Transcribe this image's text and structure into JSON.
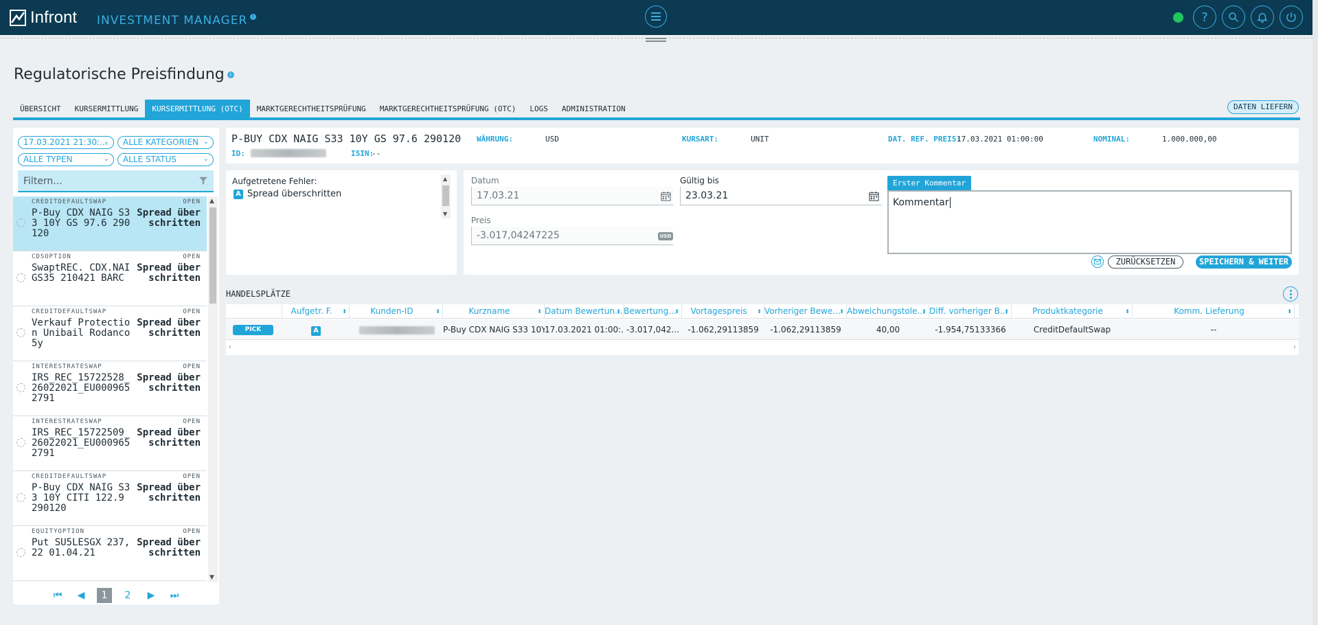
{
  "app": {
    "logo_text": "Infront",
    "title": "INVESTMENT MANAGER",
    "page_title": "Regulatorische Preisfindung"
  },
  "topbar_icons": [
    "menu-icon",
    "status-online",
    "help-icon",
    "search-icon",
    "bell-icon",
    "power-icon"
  ],
  "colors": {
    "primary": "#21a5d9",
    "topbar": "#0b3a52",
    "status_online": "#22c55e"
  },
  "tabs": [
    {
      "label": "ÜBERSICHT",
      "active": false
    },
    {
      "label": "KURSERMITTLUNG",
      "active": false
    },
    {
      "label": "KURSERMITTLUNG (OTC)",
      "active": true
    },
    {
      "label": "MARKTGERECHTHEITSPRÜFUNG",
      "active": false
    },
    {
      "label": "MARKTGERECHTHEITSPRÜFUNG (OTC)",
      "active": false
    },
    {
      "label": "LOGS",
      "active": false
    },
    {
      "label": "ADMINISTRATION",
      "active": false
    }
  ],
  "deliver_button": "DATEN LIEFERN",
  "filters": {
    "date": "17.03.2021 21:30:...",
    "categories": "ALLE KATEGORIEN",
    "types": "ALLE TYPEN",
    "status": "ALLE STATUS",
    "search_placeholder": "Filtern..."
  },
  "list_items": [
    {
      "type": "CREDITDEFAULTSWAP",
      "status": "OPEN",
      "name": "P-Buy CDX NAIG S33 10Y GS 97.6 290120",
      "msg": "Spread überschritten",
      "selected": true
    },
    {
      "type": "CDSOPTION",
      "status": "OPEN",
      "name": "SwaptREC. CDX.NAIGS35 210421 BARC",
      "msg": "Spread überschritten",
      "selected": false
    },
    {
      "type": "CREDITDEFAULTSWAP",
      "status": "OPEN",
      "name": "Verkauf Protection Unibail Rodanco 5y",
      "msg": "Spread überschritten",
      "selected": false
    },
    {
      "type": "INTERESTRATESWAP",
      "status": "OPEN",
      "name": "IRS_REC_15722528_26022021_EU0009652791",
      "msg": "Spread überschritten",
      "selected": false
    },
    {
      "type": "INTERESTRATESWAP",
      "status": "OPEN",
      "name": "IRS_REC_15722509_26022021_EU0009652791",
      "msg": "Spread überschritten",
      "selected": false
    },
    {
      "type": "CREDITDEFAULTSWAP",
      "status": "OPEN",
      "name": "P-Buy CDX NAIG S33 10Y CITI 122.9 290120",
      "msg": "Spread überschritten",
      "selected": false
    },
    {
      "type": "EQUITYOPTION",
      "status": "OPEN",
      "name": "Put SU5LESGX 237,22 01.04.21",
      "msg": "Spread überschritten",
      "selected": false
    }
  ],
  "pager": {
    "pages": [
      "1",
      "2"
    ],
    "current": "1"
  },
  "detail": {
    "title": "P-BUY CDX NAIG S33 10Y GS 97.6 290120",
    "id_label": "ID:",
    "isin_label": "ISIN:",
    "isin_value": "--",
    "currency_label": "WÄHRUNG:",
    "currency_value": "USD",
    "kursart_label": "KURSART:",
    "kursart_value": "UNIT",
    "ref_label": "DAT. REF. PREIS:",
    "ref_value": "17.03.2021 01:00:00",
    "nominal_label": "NOMINAL:",
    "nominal_value": "1.000.000,00"
  },
  "errors": {
    "title": "Aufgetretene Fehler:",
    "badge": "A",
    "items": [
      "Spread überschritten"
    ]
  },
  "form": {
    "date_label": "Datum",
    "date_value": "17.03.21",
    "valid_label": "Gültig bis",
    "valid_value": "23.03.21",
    "price_label": "Preis",
    "price_value": "-3.017,04247225",
    "currency_tag": "USD",
    "comment_tab": "Erster Kommentar",
    "comment_value": "Kommentar",
    "reset_button": "ZURÜCKSETZEN",
    "save_button": "SPEICHERN & WEITER"
  },
  "section_label": "HANDELSPLÄTZE",
  "grid": {
    "columns": [
      "Aufgetr. F.",
      "Kunden-ID",
      "Kurzname",
      "Datum Bewertun...",
      "Bewertung...",
      "Vortagespreis",
      "Vorheriger Bewe...",
      "Abweichungstole...",
      "Diff. vorheriger B...",
      "Produktkategorie",
      "Komm. Lieferung"
    ],
    "row": {
      "pick": "PICK",
      "badge": "A",
      "kurzname": "P-Buy CDX NAIG S33 10Y ...",
      "datum": "17.03.2021 01:00:...",
      "bewertung": "-3.017,042...",
      "vortagespreis": "-1.062,29113859",
      "vorheriger": "-1.062,29113859",
      "abweichung": "40,00",
      "diff": "-1.954,75133366",
      "produkt": "CreditDefaultSwap",
      "lieferung": "--"
    }
  }
}
